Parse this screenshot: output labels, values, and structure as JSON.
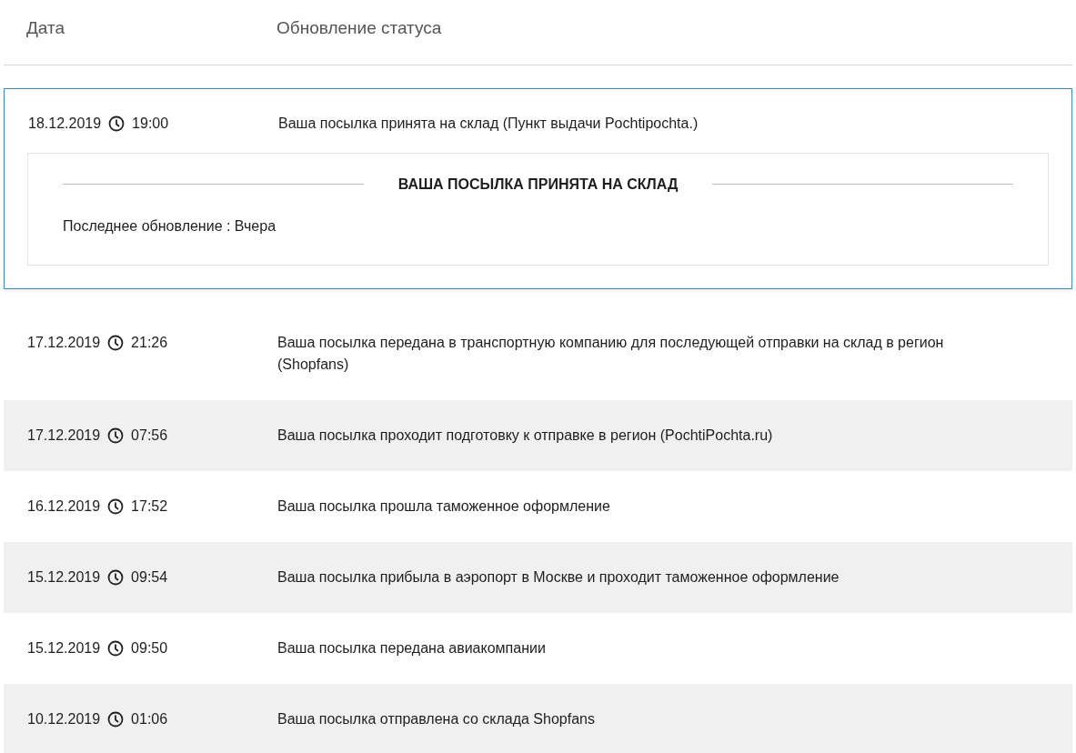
{
  "table": {
    "columns": [
      "Дата",
      "Обновление статуса"
    ],
    "rows": [
      {
        "date": "18.12.2019",
        "time": "19:00",
        "status": "Ваша посылка принята на склад (Пункт выдачи Pochtipochta.)",
        "expanded": true,
        "detail": {
          "title": "ВАША ПОСЫЛКА ПРИНЯТА НА СКЛАД",
          "last_update": "Последнее обновление : Вчера"
        }
      },
      {
        "date": "17.12.2019",
        "time": "21:26",
        "status": "Ваша посылка передана в транспортную компанию для последующей отправки на склад в регион (Shopfans)",
        "expanded": false
      },
      {
        "date": "17.12.2019",
        "time": "07:56",
        "status": "Ваша посылка проходит подготовку к отправке в регион (PochtiPochta.ru)",
        "expanded": false
      },
      {
        "date": "16.12.2019",
        "time": "17:52",
        "status": "Ваша посылка прошла таможенное оформление",
        "expanded": false
      },
      {
        "date": "15.12.2019",
        "time": "09:54",
        "status": "Ваша посылка прибыла в аэропорт в Москве и проходит таможенное оформление",
        "expanded": false
      },
      {
        "date": "15.12.2019",
        "time": "09:50",
        "status": "Ваша посылка передана авиакомпании",
        "expanded": false
      },
      {
        "date": "10.12.2019",
        "time": "01:06",
        "status": "Ваша посылка отправлена со склада Shopfans",
        "expanded": false
      }
    ]
  }
}
